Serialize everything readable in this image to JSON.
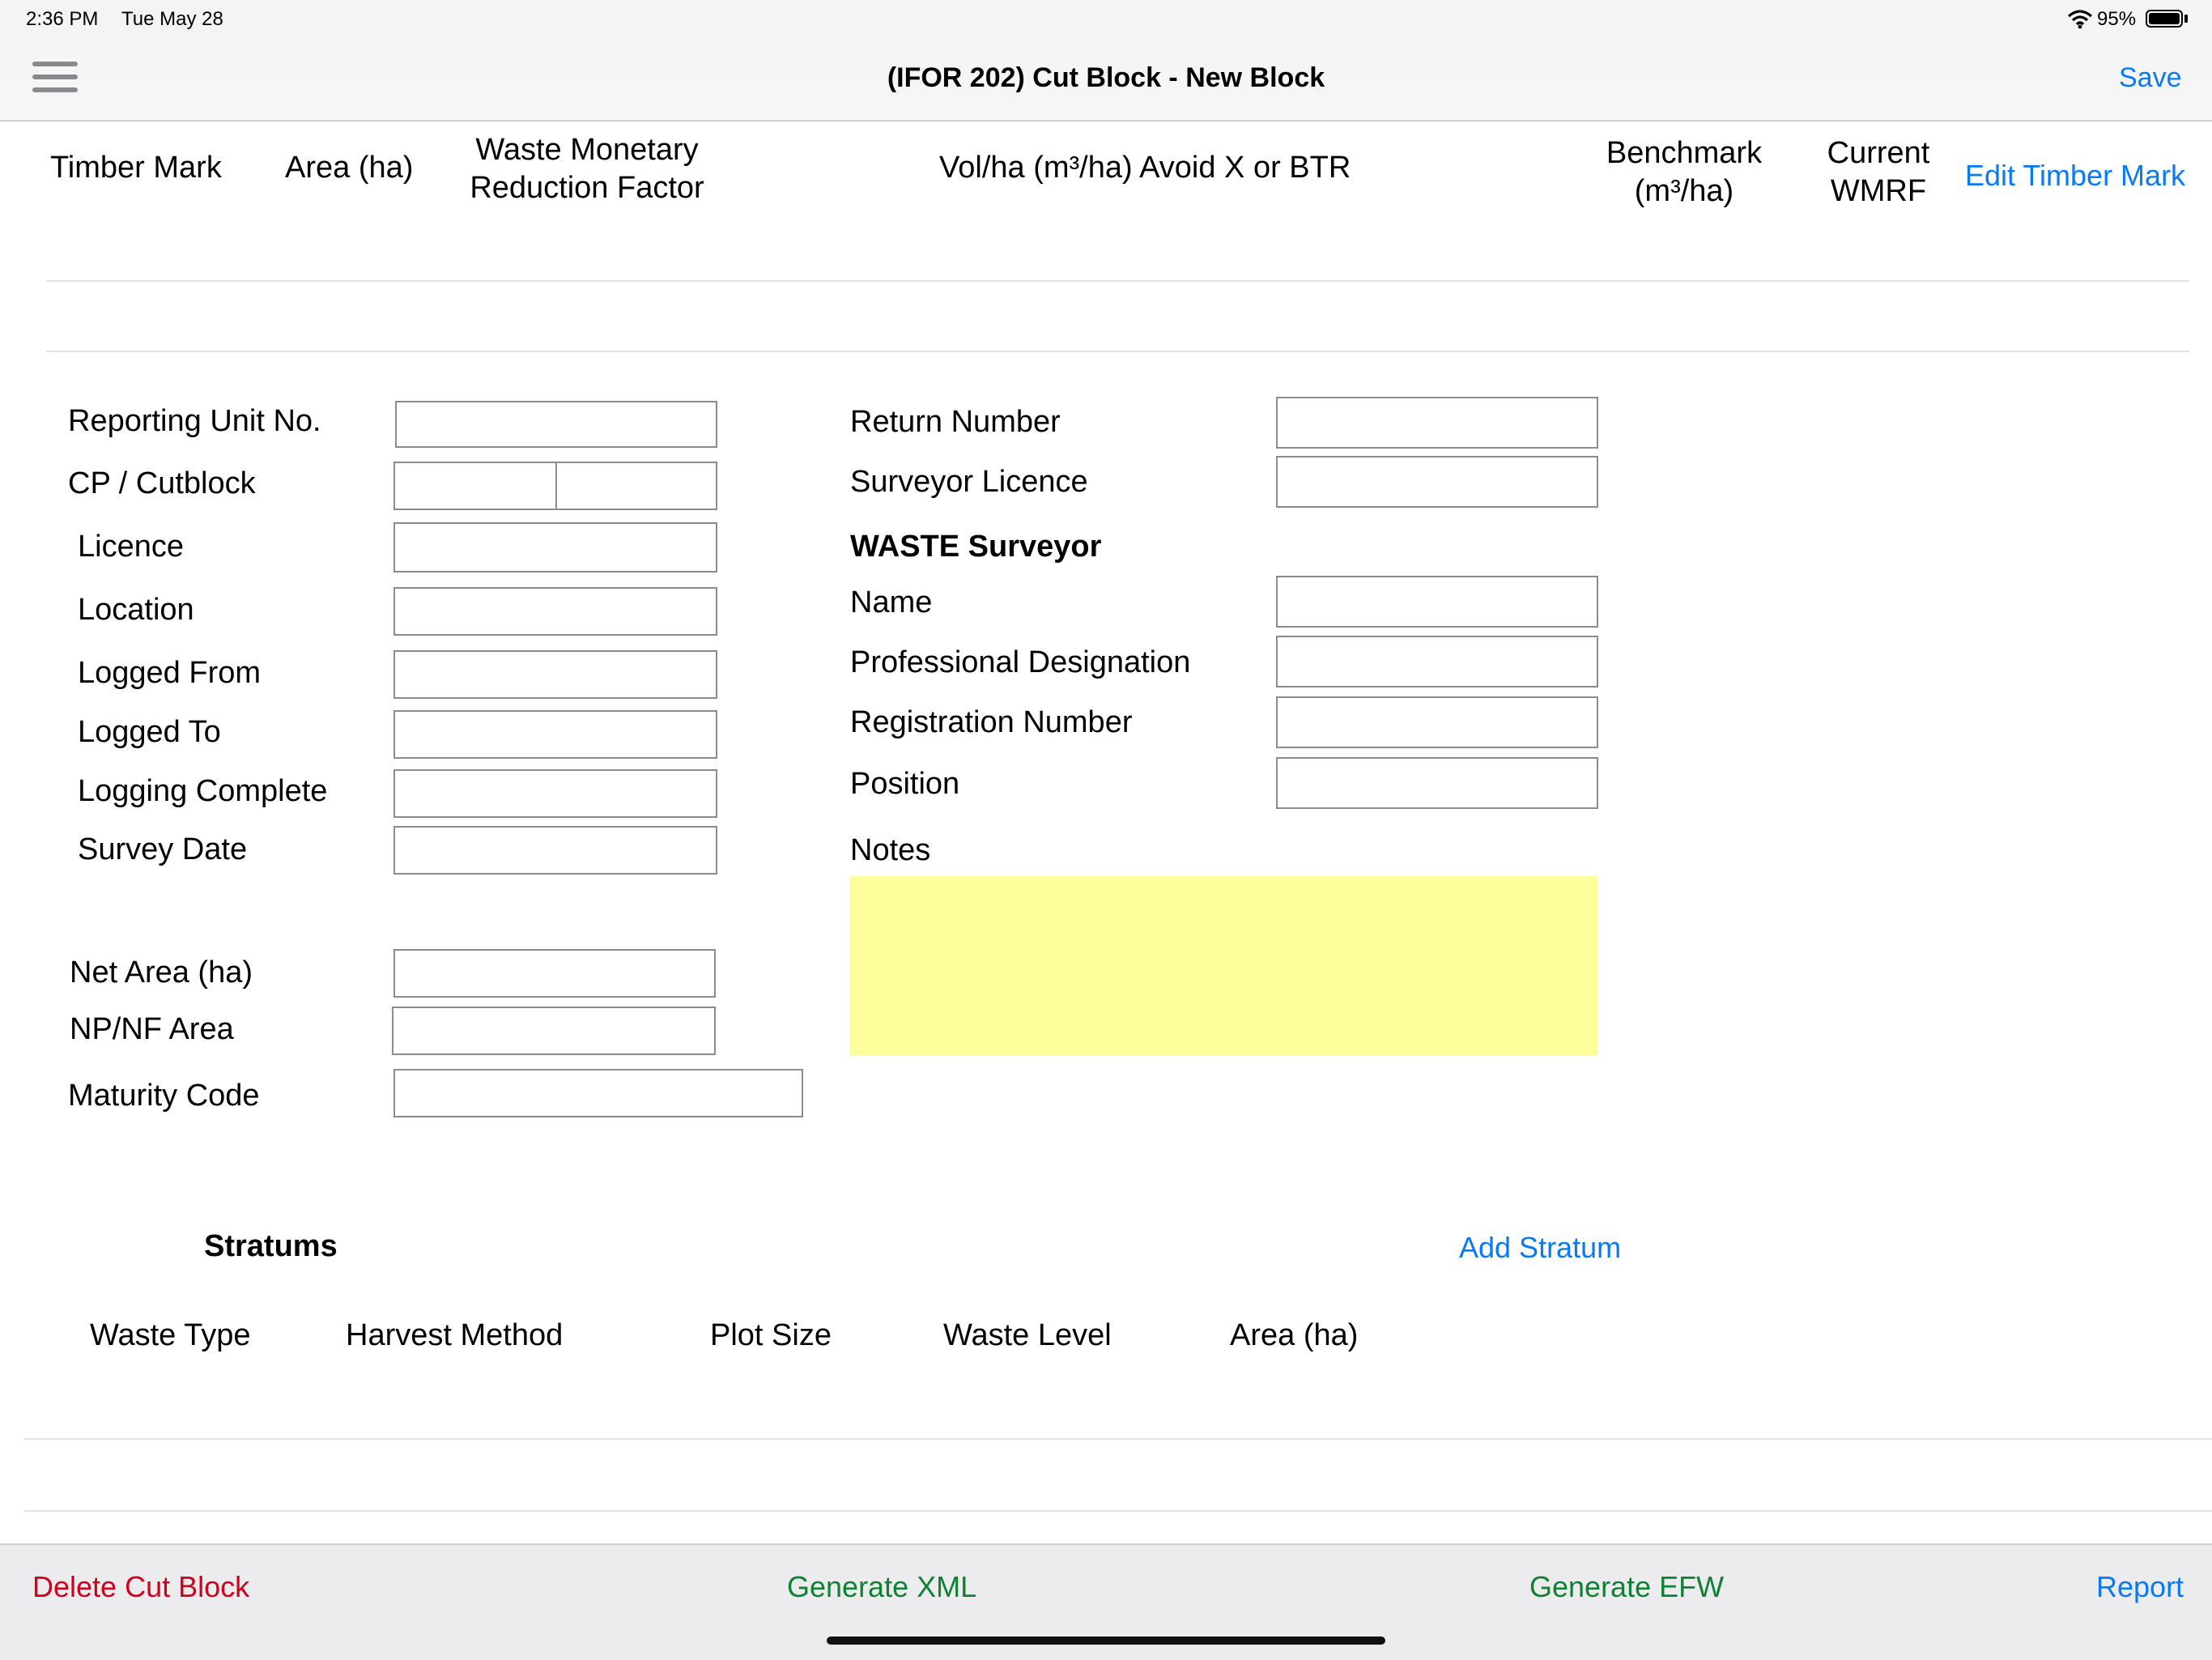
{
  "status_bar": {
    "time": "2:36 PM",
    "date": "Tue May 28",
    "battery": "95%"
  },
  "nav": {
    "title": "(IFOR 202) Cut Block - New Block",
    "save": "Save",
    "menu_icon": "hamburger-menu-icon"
  },
  "timber_table": {
    "headers": {
      "timber_mark": "Timber Mark",
      "area": "Area (ha)",
      "wmrf_line1": "Waste Monetary",
      "wmrf_line2": "Reduction Factor",
      "vol_avoid": "Vol/ha (m³/ha) Avoid X or BTR",
      "benchmark_line1": "Benchmark",
      "benchmark_line2": "(m³/ha)",
      "current_line1": "Current",
      "current_line2": "WMRF"
    },
    "edit_link": "Edit Timber Mark"
  },
  "form_left": {
    "reporting_unit": {
      "label": "Reporting Unit No.",
      "value": ""
    },
    "cp_cutblock": {
      "label": "CP / Cutblock",
      "cp_value": "",
      "cutblock_value": ""
    },
    "licence": {
      "label": "Licence",
      "value": ""
    },
    "location": {
      "label": "Location",
      "value": ""
    },
    "logged_from": {
      "label": "Logged From",
      "value": ""
    },
    "logged_to": {
      "label": "Logged To",
      "value": ""
    },
    "logging_complete": {
      "label": "Logging Complete",
      "value": ""
    },
    "survey_date": {
      "label": "Survey Date",
      "value": ""
    },
    "net_area": {
      "label": "Net Area (ha)",
      "value": ""
    },
    "np_nf_area": {
      "label": "NP/NF Area",
      "value": ""
    },
    "maturity_code": {
      "label": "Maturity Code",
      "value": ""
    }
  },
  "form_right": {
    "return_number": {
      "label": "Return Number",
      "value": ""
    },
    "surveyor_licence": {
      "label": "Surveyor Licence",
      "value": ""
    },
    "waste_surveyor_heading": "WASTE Surveyor",
    "name": {
      "label": "Name",
      "value": ""
    },
    "professional_designation": {
      "label": "Professional Designation",
      "value": ""
    },
    "registration_number": {
      "label": "Registration Number",
      "value": ""
    },
    "position": {
      "label": "Position",
      "value": ""
    },
    "notes": {
      "label": "Notes",
      "value": "",
      "color": "#fdfe9c"
    }
  },
  "stratums": {
    "title": "Stratums",
    "add_link": "Add Stratum",
    "columns": [
      "Waste Type",
      "Harvest Method",
      "Plot Size",
      "Waste Level",
      "Area (ha)"
    ]
  },
  "toolbar": {
    "delete": "Delete Cut Block",
    "generate_xml": "Generate XML",
    "generate_efw": "Generate EFW",
    "report": "Report"
  },
  "colors": {
    "link": "#0a7af4",
    "destructive": "#d0021b",
    "positive": "#0f8132"
  }
}
